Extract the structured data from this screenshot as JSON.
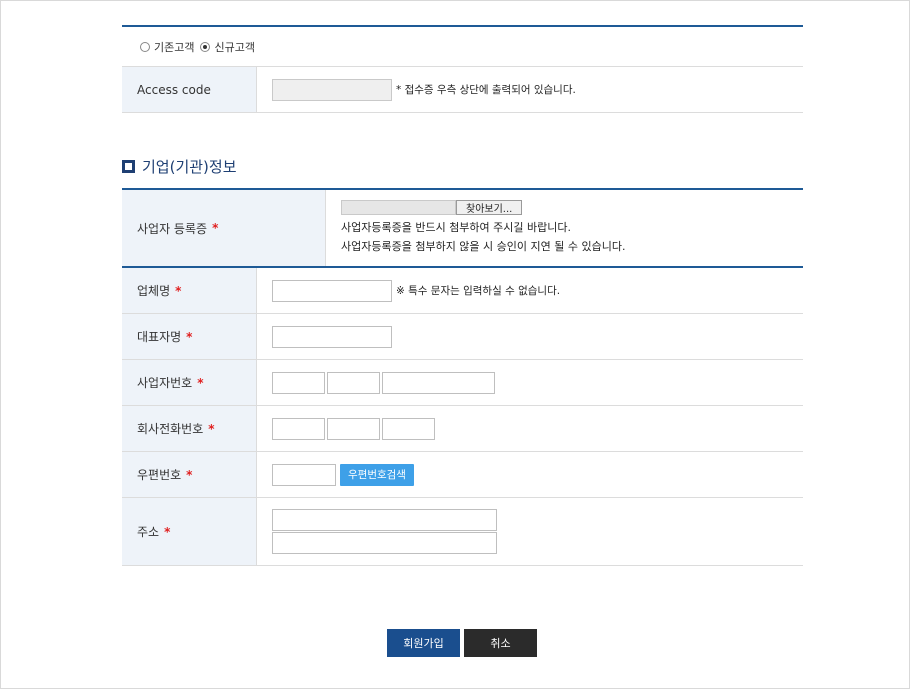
{
  "customer_type": {
    "options": [
      {
        "label": "기존고객",
        "checked": false
      },
      {
        "label": "신규고객",
        "checked": true
      }
    ],
    "access_code": {
      "label": "Access code",
      "value": "",
      "note": "* 접수증 우측 상단에 출력되어 있습니다."
    }
  },
  "section": {
    "title": "기업(기관)정보"
  },
  "form": {
    "required_mark": "*",
    "business_cert": {
      "label": "사업자 등록증",
      "browse_label": "찾아보기...",
      "help1": "사업자등록증을 반드시 첨부하여 주시길 바랍니다.",
      "help2": "사업자등록증을 첨부하지 않을 시 승인이 지연 될 수 있습니다."
    },
    "company_name": {
      "label": "업체명",
      "value": "",
      "note": "※ 특수 문자는 입력하실 수 없습니다."
    },
    "ceo_name": {
      "label": "대표자명",
      "value": ""
    },
    "biz_number": {
      "label": "사업자번호",
      "values": [
        "",
        "",
        ""
      ]
    },
    "phone": {
      "label": "회사전화번호",
      "values": [
        "",
        "",
        ""
      ]
    },
    "zipcode": {
      "label": "우편번호",
      "value": "",
      "search_label": "우편번호검색"
    },
    "address": {
      "label": "주소",
      "line1": "",
      "line2": ""
    }
  },
  "actions": {
    "join_label": "회원가입",
    "cancel_label": "취소"
  },
  "colors": {
    "accent_blue": "#1e5a96",
    "header_bg": "#eef3f9",
    "zip_button": "#3ea0e8",
    "join_button": "#1a4e8e",
    "cancel_button": "#2b2b2b",
    "required": "#e02020"
  }
}
